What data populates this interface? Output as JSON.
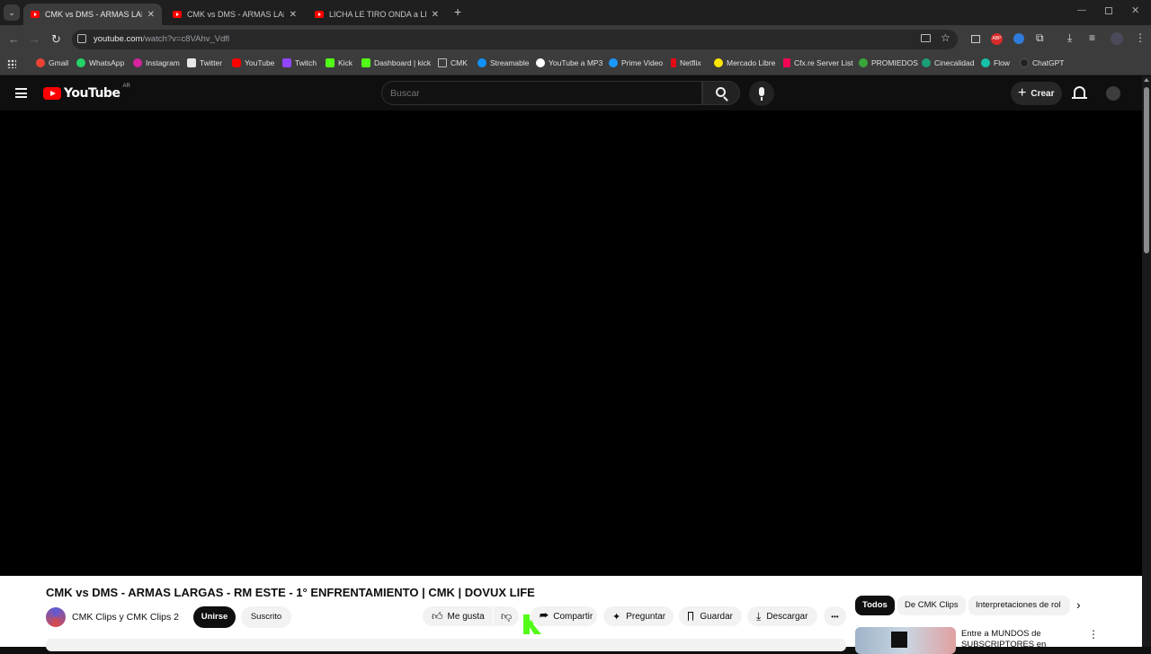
{
  "browser": {
    "tabs": [
      {
        "label": "CMK vs DMS - ARMAS LARGAS",
        "active": true
      },
      {
        "label": "CMK vs DMS - ARMAS LARGAS",
        "active": false
      },
      {
        "label": "LICHA LE TIRO ONDA a LICY y",
        "active": false
      }
    ],
    "close_glyph": "✕",
    "new_tab_glyph": "+",
    "url_host": "youtube.com",
    "url_path": "/watch?v=c8VAhv_Vdfl",
    "bookmarks": [
      {
        "label": "Gmail",
        "color": "#ea4335"
      },
      {
        "label": "WhatsApp",
        "color": "#25d366"
      },
      {
        "label": "Instagram",
        "color": "#d6249f"
      },
      {
        "label": "Twitter",
        "color": "#e7e7e7"
      },
      {
        "label": "YouTube",
        "color": "#ff0000"
      },
      {
        "label": "Twitch",
        "color": "#9146ff"
      },
      {
        "label": "Kick",
        "color": "#53fc18"
      },
      {
        "label": "Dashboard | kick",
        "color": "#53fc18"
      },
      {
        "label": "CMK",
        "color": "#9aa0a6"
      },
      {
        "label": "Streamable",
        "color": "#0f90fa"
      },
      {
        "label": "YouTube a MP3",
        "color": "#ffffff"
      },
      {
        "label": "Prime Video",
        "color": "#1a98ff"
      },
      {
        "label": "Netflix",
        "color": "#e50914"
      },
      {
        "label": "Mercado Libre",
        "color": "#ffe600"
      },
      {
        "label": "Cfx.re Server List",
        "color": "#f40552"
      },
      {
        "label": "PROMIEDOS",
        "color": "#3aa63a"
      },
      {
        "label": "Cinecalidad",
        "color": "#1b9e77"
      },
      {
        "label": "Flow",
        "color": "#16c3a8"
      },
      {
        "label": "ChatGPT",
        "color": "#222222"
      }
    ]
  },
  "youtube": {
    "logo_text": "YouTube",
    "country_code": "AR",
    "search_placeholder": "Buscar",
    "create_label": "Crear",
    "video_title": "CMK vs DMS - ARMAS LARGAS - RM ESTE - 1° ENFRENTAMIENTO | CMK | DOVUX LIFE",
    "channel_name": "CMK Clips y CMK Clips 2",
    "join_label": "Unirse",
    "subscribed_label": "Suscrito",
    "like_label": "Me gusta",
    "share_label": "Compartir",
    "ask_label": "Preguntar",
    "save_label": "Guardar",
    "download_label": "Descargar",
    "more_glyph": "•••",
    "chips": [
      "Todos",
      "De CMK Clips",
      "Interpretaciones de rol"
    ],
    "reco_title_line1": "Entre a MUNDOS de",
    "reco_title_line2": "SUBSCRIPTORES en"
  },
  "colors": {
    "yt_red": "#ff0000",
    "kick_green": "#53fc18",
    "dark_bg": "#0f0f0f"
  }
}
